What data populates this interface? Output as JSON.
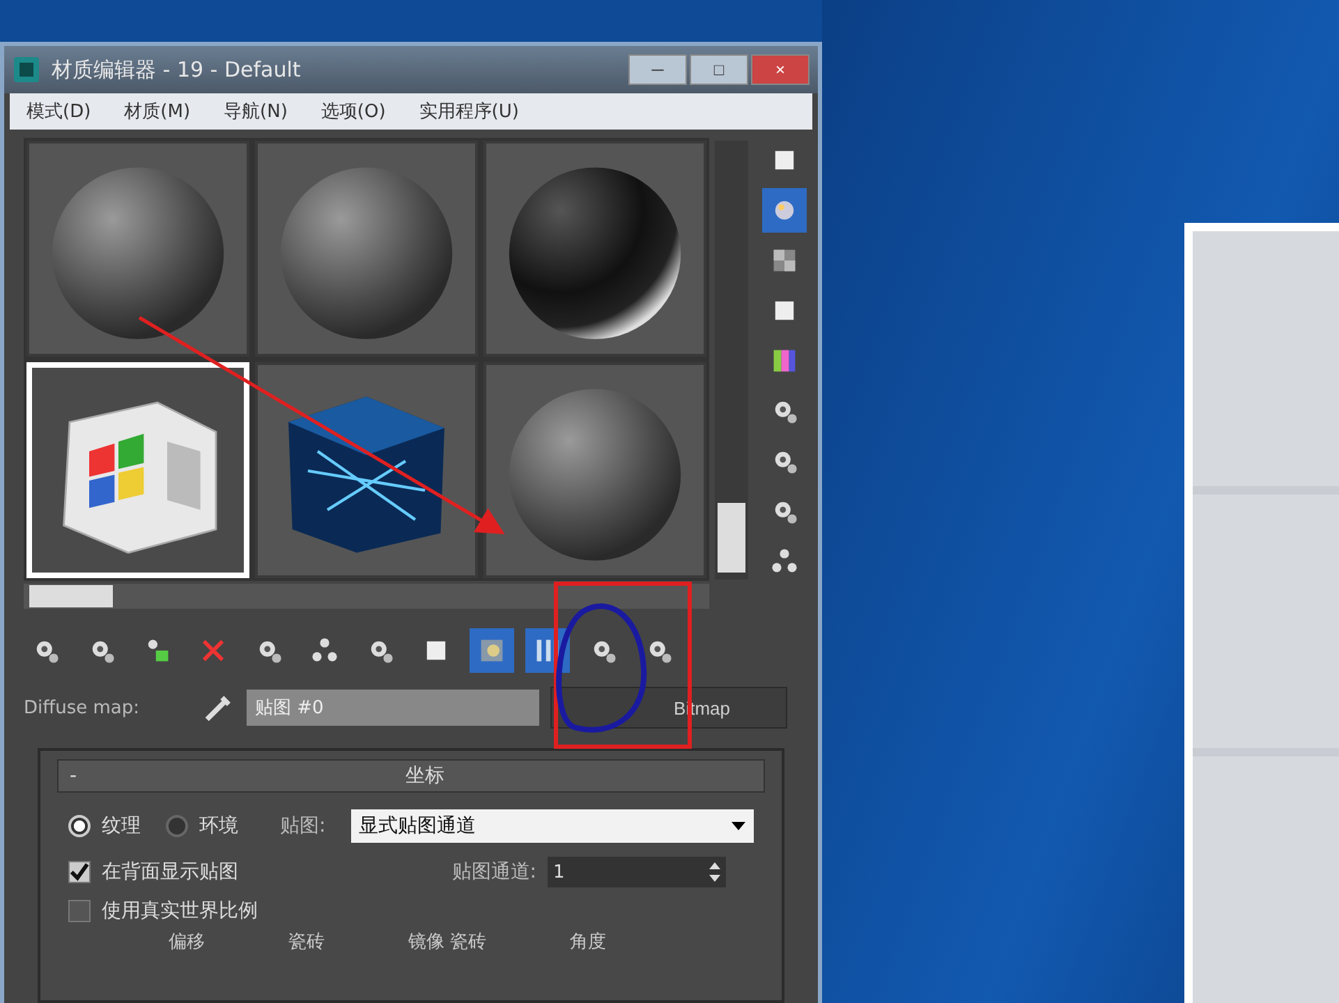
{
  "window": {
    "title": "材质编辑器 - 19 - Default",
    "controls": [
      "─",
      "□",
      "×"
    ]
  },
  "menu": [
    "模式(D)",
    "材质(M)",
    "导航(N)",
    "选项(O)",
    "实用程序(U)"
  ],
  "slots": [
    {
      "kind": "sphere",
      "selected": false
    },
    {
      "kind": "sphere",
      "selected": false
    },
    {
      "kind": "dark-sphere",
      "selected": false
    },
    {
      "kind": "logo-cube",
      "selected": true
    },
    {
      "kind": "blue-cube",
      "selected": false
    },
    {
      "kind": "sphere",
      "selected": false
    }
  ],
  "side_tools": [
    {
      "kind": "square",
      "selected": false
    },
    {
      "kind": "light",
      "selected": true
    },
    {
      "kind": "checker",
      "selected": false
    },
    {
      "kind": "square",
      "selected": false
    },
    {
      "kind": "colors",
      "selected": false
    },
    {
      "kind": "gear",
      "selected": false
    },
    {
      "kind": "gear",
      "selected": false
    },
    {
      "kind": "gear",
      "selected": false
    },
    {
      "kind": "dots",
      "selected": false
    }
  ],
  "tools": [
    {
      "kind": "gear",
      "selected": false
    },
    {
      "kind": "gear",
      "selected": false
    },
    {
      "kind": "green",
      "selected": false
    },
    {
      "kind": "delete",
      "selected": false
    },
    {
      "kind": "gear",
      "selected": false
    },
    {
      "kind": "dots",
      "selected": false
    },
    {
      "kind": "gear",
      "selected": false
    },
    {
      "kind": "square",
      "selected": false
    },
    {
      "kind": "map",
      "selected": true
    },
    {
      "kind": "bars",
      "selected": true
    },
    {
      "kind": "gear",
      "selected": false
    },
    {
      "kind": "gear",
      "selected": false
    }
  ],
  "map_row": {
    "label": "Diffuse map:",
    "value": "贴图 #0",
    "type_button": "Bitmap"
  },
  "rollout": {
    "title": "坐标",
    "collapse": "-",
    "radios": [
      {
        "label": "纹理",
        "selected": true
      },
      {
        "label": "环境",
        "selected": false
      }
    ],
    "mapping_label": "贴图:",
    "mapping_value": "显式贴图通道",
    "checks": [
      {
        "label": "在背面显示贴图",
        "checked": true
      },
      {
        "label": "使用真实世界比例",
        "checked": false
      }
    ],
    "channel_label": "贴图通道:",
    "channel_value": "1",
    "columns": [
      "偏移",
      "瓷砖",
      "镜像 瓷砖",
      "角度"
    ]
  }
}
